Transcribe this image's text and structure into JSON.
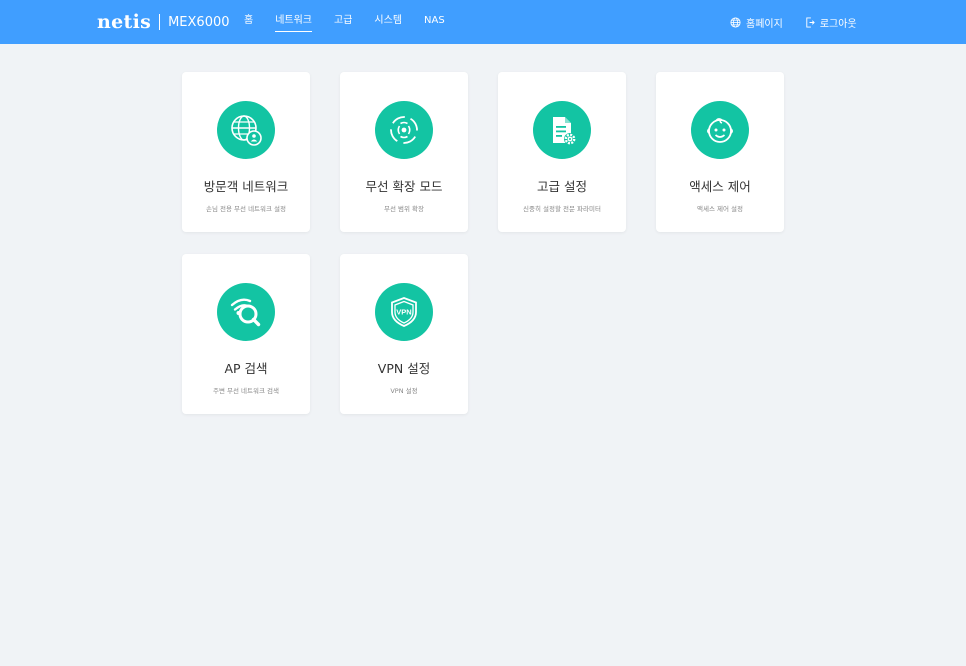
{
  "header": {
    "logo": "netis",
    "model": "MEX6000",
    "nav": [
      {
        "label": "홈",
        "active": false
      },
      {
        "label": "네트워크",
        "active": true
      },
      {
        "label": "고급",
        "active": false
      },
      {
        "label": "시스템",
        "active": false
      },
      {
        "label": "NAS",
        "active": false
      }
    ],
    "homepage_label": "홈페이지",
    "logout_label": "로그아웃"
  },
  "cards": [
    {
      "title": "방문객 네트워크",
      "subtitle": "손님 전용 무선 네트워크 설정",
      "icon": "guest-network-icon"
    },
    {
      "title": "무선 확장 모드",
      "subtitle": "무선 범위 확장",
      "icon": "wireless-extend-icon"
    },
    {
      "title": "고급 설정",
      "subtitle": "신중히 설정할 전문 파라미터",
      "icon": "advanced-settings-icon"
    },
    {
      "title": "액세스 제어",
      "subtitle": "액세스 제어 설정",
      "icon": "access-control-icon"
    },
    {
      "title": "AP 검색",
      "subtitle": "주변 무선 네트워크 검색",
      "icon": "ap-search-icon"
    },
    {
      "title": "VPN 설정",
      "subtitle": "VPN 설정",
      "icon": "vpn-icon"
    }
  ],
  "colors": {
    "header": "#409eff",
    "accent": "#13c4a3",
    "background": "#f0f3f6"
  }
}
